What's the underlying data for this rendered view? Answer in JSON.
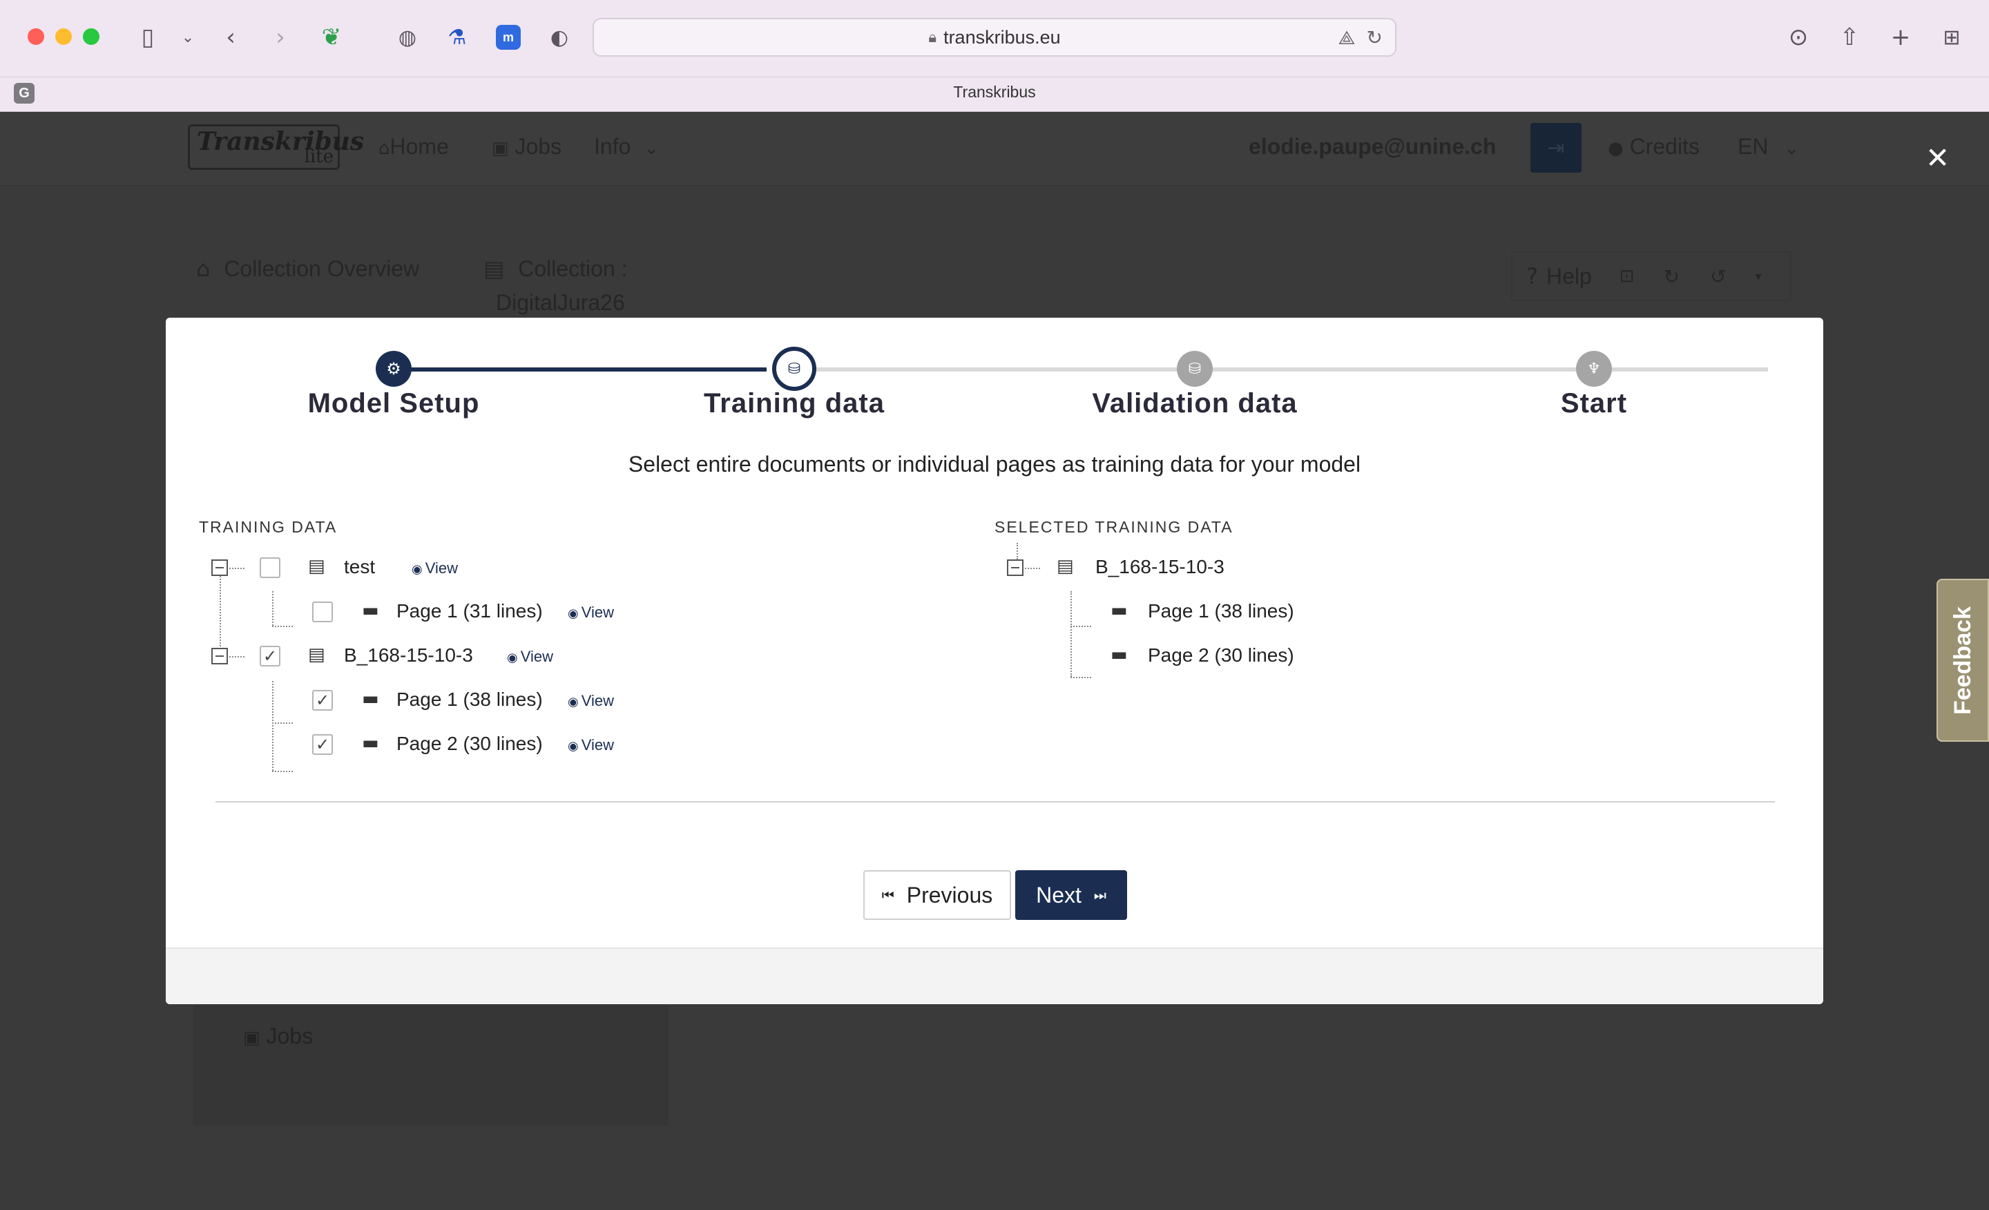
{
  "browser": {
    "url": "transkribus.eu",
    "tab_title": "Transkribus",
    "tab_favicon": "G",
    "icons": [
      "sidebar-icon",
      "chevron-down-icon",
      "back-icon",
      "forward-icon",
      "evernote-icon",
      "globe-icon",
      "flask-icon",
      "extension-icon",
      "shield-icon",
      "translate-icon",
      "reload-icon",
      "download-icon",
      "share-icon",
      "new-tab-icon",
      "tab-overview-icon"
    ]
  },
  "app_nav": {
    "brand": "Transkribus",
    "brand_sub": "lite",
    "home": "Home",
    "jobs": "Jobs",
    "info": "Info",
    "user": "elodie.paupe@unine.ch",
    "credits": "Credits",
    "language": "EN"
  },
  "breadcrumb": {
    "overview": "Collection Overview",
    "collection_label": "Collection :",
    "collection_name": "DigitalJura26"
  },
  "toolbar": {
    "help": "Help"
  },
  "sidebar": {
    "jobs": "Jobs"
  },
  "wizard": {
    "steps": [
      {
        "label": "Model Setup",
        "state": "done"
      },
      {
        "label": "Training data",
        "state": "active"
      },
      {
        "label": "Validation data",
        "state": "todo"
      },
      {
        "label": "Start",
        "state": "todo"
      }
    ],
    "instruction": "Select entire documents or individual pages as training data for your model",
    "training_title": "TRAINING DATA",
    "selected_title": "SELECTED TRAINING DATA",
    "view_label": "View",
    "training_tree": [
      {
        "name": "test",
        "checked": false,
        "pages": [
          {
            "name": "Page 1 (31 lines)",
            "checked": false
          }
        ]
      },
      {
        "name": "B_168-15-10-3",
        "checked": true,
        "pages": [
          {
            "name": "Page 1 (38 lines)",
            "checked": true
          },
          {
            "name": "Page 2 (30 lines)",
            "checked": true
          }
        ]
      }
    ],
    "selected_tree": {
      "name": "B_168-15-10-3",
      "pages": [
        "Page 1 (38 lines)",
        "Page 2 (30 lines)"
      ]
    },
    "previous": "Previous",
    "next": "Next"
  },
  "feedback": "Feedback",
  "colors": {
    "primary": "#1b2e52",
    "inactive_step": "#a5a5a5",
    "feedback": "#9a9272"
  }
}
